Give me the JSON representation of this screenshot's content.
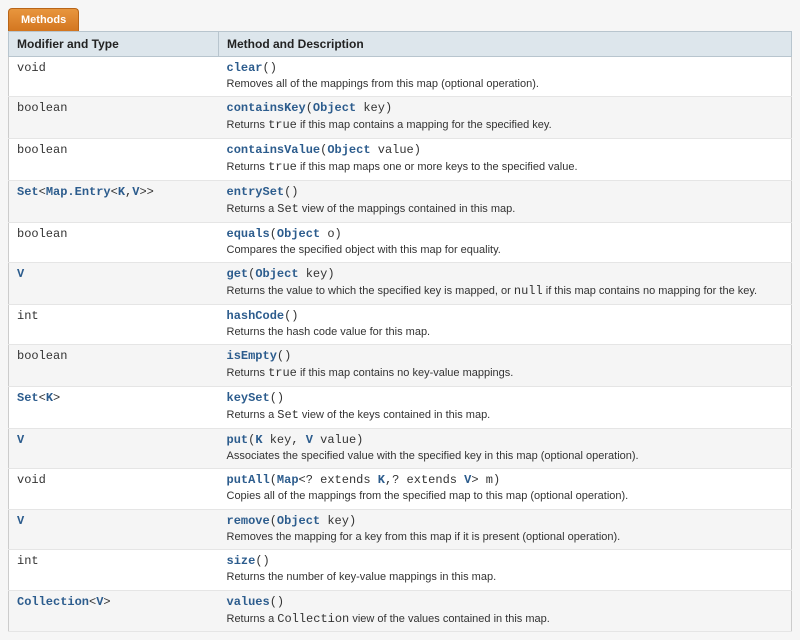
{
  "tab_label": "Methods",
  "columns": {
    "modifier": "Modifier and Type",
    "method": "Method and Description"
  },
  "rows": [
    {
      "modifier_html": "void",
      "sig_html": "<a class='mlink'>clear</a>()",
      "desc_html": "Removes all of the mappings from this map (optional operation)."
    },
    {
      "modifier_html": "boolean",
      "sig_html": "<a class='mlink'>containsKey</a>(<a class='tlink'>Object</a> key)",
      "desc_html": "Returns <code>true</code> if this map contains a mapping for the specified key."
    },
    {
      "modifier_html": "boolean",
      "sig_html": "<a class='mlink'>containsValue</a>(<a class='tlink'>Object</a> value)",
      "desc_html": "Returns <code>true</code> if this map maps one or more keys to the specified value."
    },
    {
      "modifier_html": "<a class='tlink'>Set</a>&lt;<a class='tlink'>Map.Entry</a>&lt;<a class='tlink'>K</a>,<a class='tlink'>V</a>&gt;&gt;",
      "sig_html": "<a class='mlink'>entrySet</a>()",
      "desc_html": "Returns a <code>Set</code> view of the mappings contained in this map."
    },
    {
      "modifier_html": "boolean",
      "sig_html": "<a class='mlink'>equals</a>(<a class='tlink'>Object</a> o)",
      "desc_html": "Compares the specified object with this map for equality."
    },
    {
      "modifier_html": "<a class='tlink'>V</a>",
      "sig_html": "<a class='mlink'>get</a>(<a class='tlink'>Object</a> key)",
      "desc_html": "Returns the value to which the specified key is mapped, or <code>null</code> if this map contains no mapping for the key."
    },
    {
      "modifier_html": "int",
      "sig_html": "<a class='mlink'>hashCode</a>()",
      "desc_html": "Returns the hash code value for this map."
    },
    {
      "modifier_html": "boolean",
      "sig_html": "<a class='mlink'>isEmpty</a>()",
      "desc_html": "Returns <code>true</code> if this map contains no key-value mappings."
    },
    {
      "modifier_html": "<a class='tlink'>Set</a>&lt;<a class='tlink'>K</a>&gt;",
      "sig_html": "<a class='mlink'>keySet</a>()",
      "desc_html": "Returns a <code>Set</code> view of the keys contained in this map."
    },
    {
      "modifier_html": "<a class='tlink'>V</a>",
      "sig_html": "<a class='mlink'>put</a>(<a class='tlink'>K</a> key, <a class='tlink'>V</a> value)",
      "desc_html": "Associates the specified value with the specified key in this map (optional operation)."
    },
    {
      "modifier_html": "void",
      "sig_html": "<a class='mlink'>putAll</a>(<a class='tlink'>Map</a>&lt;? extends <a class='tlink'>K</a>,? extends <a class='tlink'>V</a>&gt; m)",
      "desc_html": "Copies all of the mappings from the specified map to this map (optional operation)."
    },
    {
      "modifier_html": "<a class='tlink'>V</a>",
      "sig_html": "<a class='mlink'>remove</a>(<a class='tlink'>Object</a> key)",
      "desc_html": "Removes the mapping for a key from this map if it is present (optional operation)."
    },
    {
      "modifier_html": "int",
      "sig_html": "<a class='mlink'>size</a>()",
      "desc_html": "Returns the number of key-value mappings in this map."
    },
    {
      "modifier_html": "<a class='tlink'>Collection</a>&lt;<a class='tlink'>V</a>&gt;",
      "sig_html": "<a class='mlink'>values</a>()",
      "desc_html": "Returns a <code>Collection</code> view of the values contained in this map."
    }
  ]
}
